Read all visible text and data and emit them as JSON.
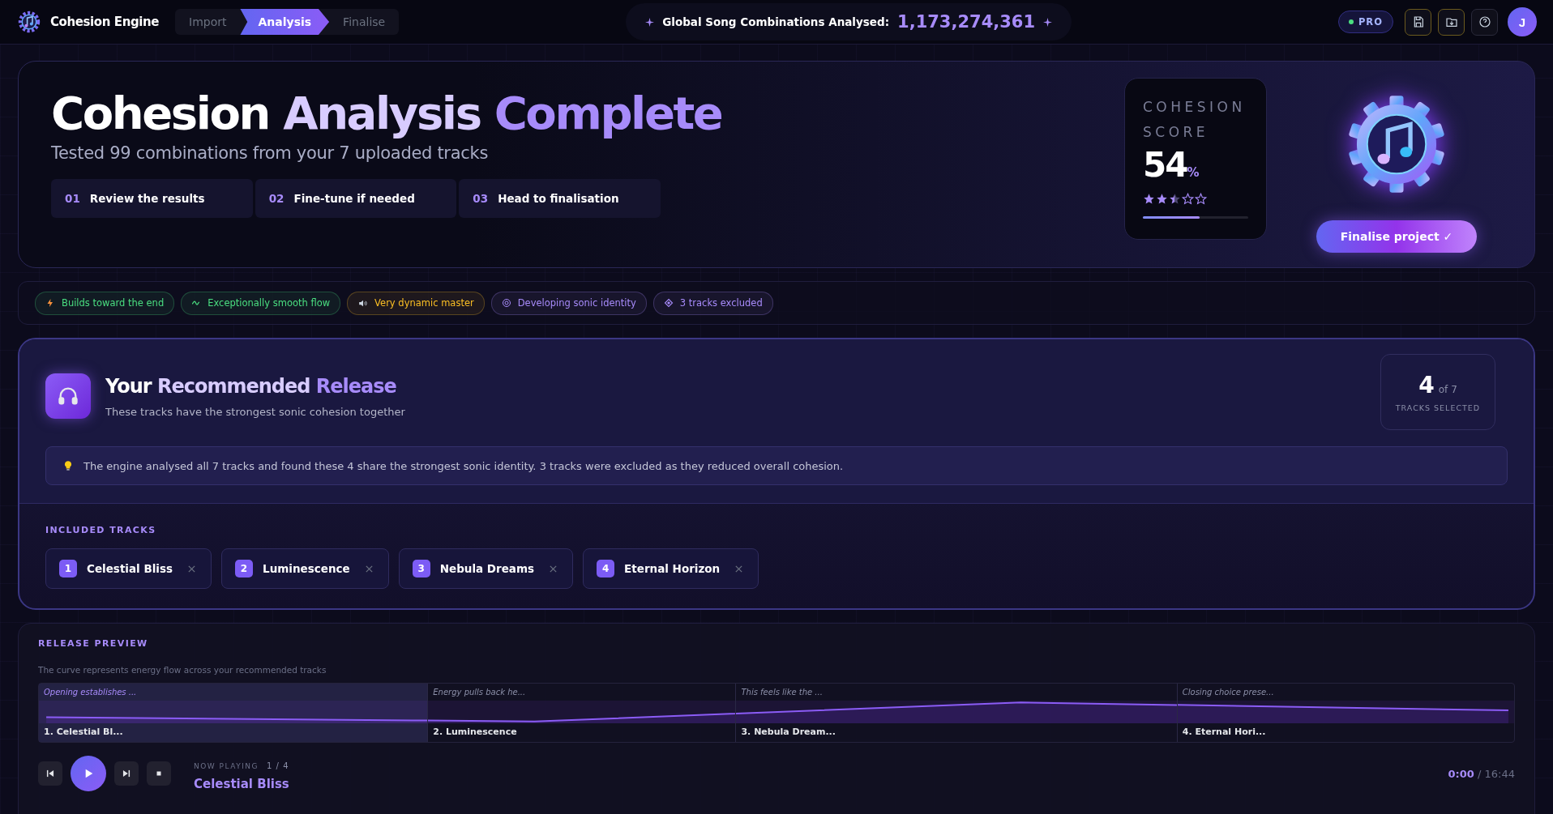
{
  "app": {
    "name": "Cohesion Engine"
  },
  "steps_nav": [
    {
      "label": "Import",
      "selected": false
    },
    {
      "label": "Analysis",
      "selected": true
    },
    {
      "label": "Finalise",
      "selected": false
    }
  ],
  "counter": {
    "label": "Global Song Combinations Analysed:",
    "value": "1,173,274,361"
  },
  "header_actions": {
    "badge": "PRO",
    "avatar": "J"
  },
  "hero": {
    "title_parts": [
      "Cohesion",
      "Analysis",
      "Complete"
    ],
    "subtitle": "Tested 99 combinations from your 7 uploaded tracks",
    "steps": [
      {
        "number": "01",
        "label": "Review the results"
      },
      {
        "number": "02",
        "label": "Fine-tune if needed"
      },
      {
        "number": "03",
        "label": "Head to finalisation"
      }
    ],
    "score": {
      "label": "COHESION SCORE",
      "value": "54",
      "unit": "%",
      "stars": 2.5,
      "level": 0.54
    },
    "button": "Finalise project ✓"
  },
  "tags": [
    {
      "label": "Builds toward the end",
      "color": "#4ade80"
    },
    {
      "label": "Exceptionally smooth flow",
      "color": "#4ade80"
    },
    {
      "label": "Very dynamic master",
      "color": "#fbbf24"
    },
    {
      "label": "Developing sonic identity",
      "color": "#a78bfa"
    },
    {
      "label": "3 tracks excluded",
      "color": "#a78bfa"
    }
  ],
  "recommended": {
    "title_parts": [
      "Your",
      "Recommended",
      "Release"
    ],
    "subtitle": "These tracks have the strongest sonic cohesion together",
    "count": "4",
    "count_of": "of 7",
    "count_label": "TRACKS SELECTED",
    "note": "The engine analysed all 7 tracks and found these 4 share the strongest sonic identity. 3 tracks were excluded as they reduced overall cohesion.",
    "included_label": "INCLUDED TRACKS",
    "tracks": [
      {
        "number": "1",
        "name": "Celestial Bliss"
      },
      {
        "number": "2",
        "name": "Luminescence"
      },
      {
        "number": "3",
        "name": "Nebula Dreams"
      },
      {
        "number": "4",
        "name": "Eternal Horizon"
      }
    ]
  },
  "preview": {
    "label": "RELEASE PREVIEW",
    "caption": "The curve represents energy flow across your recommended tracks",
    "segments": [
      {
        "caption": "Opening establishes ...",
        "title": "1. Celestial Bl...",
        "selected": true
      },
      {
        "caption": "Energy pulls back he...",
        "title": "2. Luminescence",
        "selected": false
      },
      {
        "caption": "This feels like the ...",
        "title": "3. Nebula Dream...",
        "selected": false
      },
      {
        "caption": "Closing choice prese...",
        "title": "4. Eternal Hori...",
        "selected": false
      }
    ],
    "player": {
      "now_label": "NOW PLAYING",
      "position": "1 / 4",
      "track": "Celestial Bliss",
      "elapsed": "0:00",
      "total": "/ 16:44"
    }
  }
}
